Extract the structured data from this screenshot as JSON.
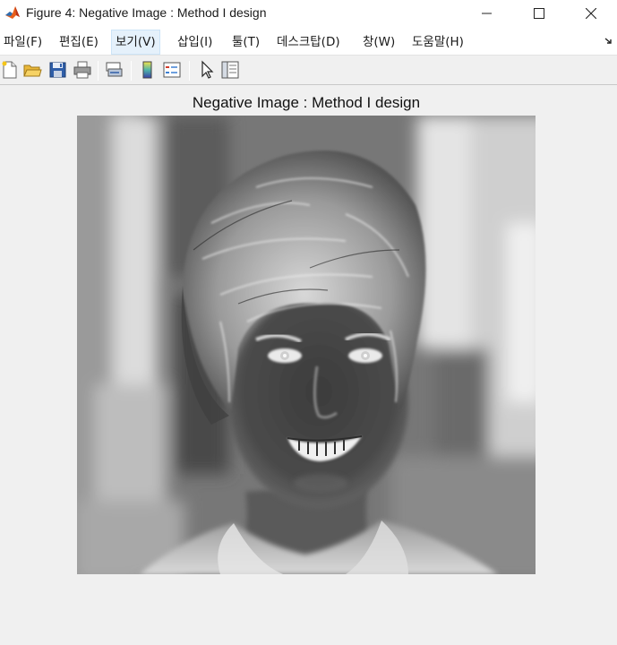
{
  "window": {
    "title": "Figure 4: Negative Image : Method I design",
    "app_icon": "matlab-logo-icon"
  },
  "title_controls": {
    "minimize": "minimize-icon",
    "maximize": "maximize-icon",
    "close": "close-icon"
  },
  "menu": {
    "items": [
      {
        "label": "파일(F)"
      },
      {
        "label": "편집(E)"
      },
      {
        "label": "보기(V)",
        "active": true
      },
      {
        "label": "삽입(I)"
      },
      {
        "label": "툴(T)"
      },
      {
        "label": "데스크탑(D)"
      },
      {
        "label": "창(W)"
      },
      {
        "label": "도움말(H)"
      }
    ],
    "overflow_icon": "dock-arrow-icon"
  },
  "toolbar": {
    "buttons": [
      {
        "icon": "new-figure-icon"
      },
      {
        "icon": "open-file-icon"
      },
      {
        "icon": "save-icon"
      },
      {
        "icon": "print-icon"
      },
      {
        "icon": "link-plot-icon"
      },
      {
        "icon": "colorbar-icon"
      },
      {
        "icon": "legend-icon"
      },
      {
        "icon": "pointer-icon"
      },
      {
        "icon": "property-editor-icon"
      }
    ]
  },
  "figure": {
    "axes_title": "Negative Image : Method I design",
    "image_description_icon": "negative-portrait-image"
  },
  "colors": {
    "titlebar_bg": "#ffffff",
    "menubar_bg": "#ffffff",
    "figure_bg": "#f0f0f0",
    "active_menu_bg": "#e5f1fb"
  }
}
